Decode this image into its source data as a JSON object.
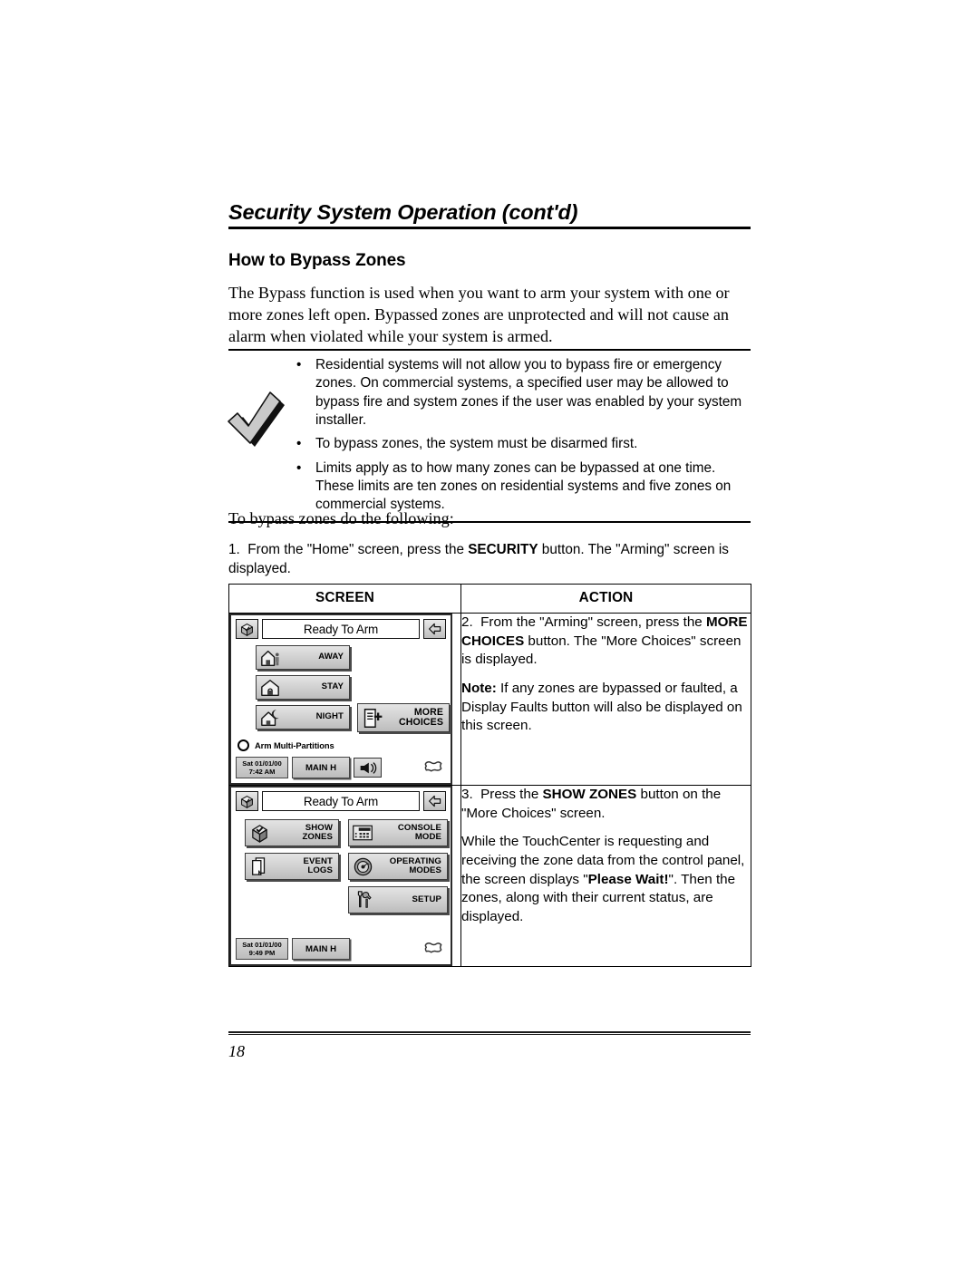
{
  "document": {
    "running_head": "Security System Operation (cont'd)",
    "section_title": "How to Bypass Zones",
    "intro_paragraph": "The Bypass function is used when you want to arm your system with one or more zones left open. Bypassed zones are unprotected and will not cause an alarm when violated while your system is armed.",
    "page_number": "18"
  },
  "callout": {
    "icon": "checkmark-icon",
    "bullets": [
      "Residential systems will not allow you to bypass fire or emergency zones. On commercial systems, a specified user may be allowed to bypass fire and system zones if the user was enabled by your system installer.",
      "To bypass zones, the system must be disarmed first.",
      "Limits apply as to how many zones can be bypassed at one time. These limits are ten zones on residential systems and five zones on commercial systems."
    ]
  },
  "procedure": {
    "lead_in": "To bypass zones do the following:",
    "step1_number": "1.",
    "step1_text_a": "From the \"Home\" screen, press the ",
    "step1_bold": "SECURITY",
    "step1_text_b": " button.  The \"Arming\" screen is displayed.",
    "table_headers": {
      "screen": "SCREEN",
      "action": "ACTION"
    }
  },
  "row1": {
    "action": {
      "step_number": "2.",
      "para1_a": "From the \"Arming\" screen, press the ",
      "para1_bold": "MORE CHOICES",
      "para1_b": " button.  The \"More Choices\" screen is displayed.",
      "note_label": "Note:",
      "note_text": " If any zones are bypassed or faulted, a Display Faults button will also be displayed on this screen."
    },
    "screen": {
      "home_icon": "home-cube-icon",
      "title": "Ready To Arm",
      "back_icon": "back-arrow-icon",
      "buttons": [
        {
          "label": "AWAY",
          "icon": "house-person-icon"
        },
        {
          "label": "STAY",
          "icon": "house-lock-icon"
        },
        {
          "label": "NIGHT",
          "icon": "house-moon-icon"
        },
        {
          "label": "MORE\nCHOICES",
          "icon": "document-plus-icon"
        }
      ],
      "multi_partition_label": "Arm Multi-Partitions",
      "status_date": "Sat 01/01/00",
      "status_time": "7:42 AM",
      "status_partition": "MAIN H",
      "speaker_icon": "speaker-icon",
      "logo_icon": "shield-logo-icon"
    }
  },
  "row2": {
    "action": {
      "step_number": "3.",
      "para1_a": "Press the ",
      "para1_bold": "SHOW ZONES",
      "para1_b": " button on the \"More Choices\" screen.",
      "para2_a": "While the TouchCenter is requesting and receiving the zone data from the control panel, the screen displays \"",
      "para2_bold": "Please Wait!",
      "para2_b": "\".  Then the zones, along with their current status, are displayed."
    },
    "screen": {
      "home_icon": "home-cube-icon",
      "title": "Ready To Arm",
      "back_icon": "back-arrow-icon",
      "buttons": [
        {
          "label": "SHOW\nZONES",
          "icon": "cube-icon"
        },
        {
          "label": "CONSOLE\nMODE",
          "icon": "keypad-icon"
        },
        {
          "label": "EVENT\nLOGS",
          "icon": "pages-icon"
        },
        {
          "label": "OPERATING\nMODES",
          "icon": "dial-icon"
        },
        {
          "label": "SETUP",
          "icon": "tools-icon"
        }
      ],
      "status_date": "Sat 01/01/00",
      "status_time": "9:49 PM",
      "status_partition": "MAIN H",
      "logo_icon": "shield-logo-icon"
    }
  },
  "colors": {
    "ink": "#000000",
    "paper": "#ffffff",
    "button_face": "#cfcfcf",
    "callout_grey": "#c8c8c8"
  }
}
